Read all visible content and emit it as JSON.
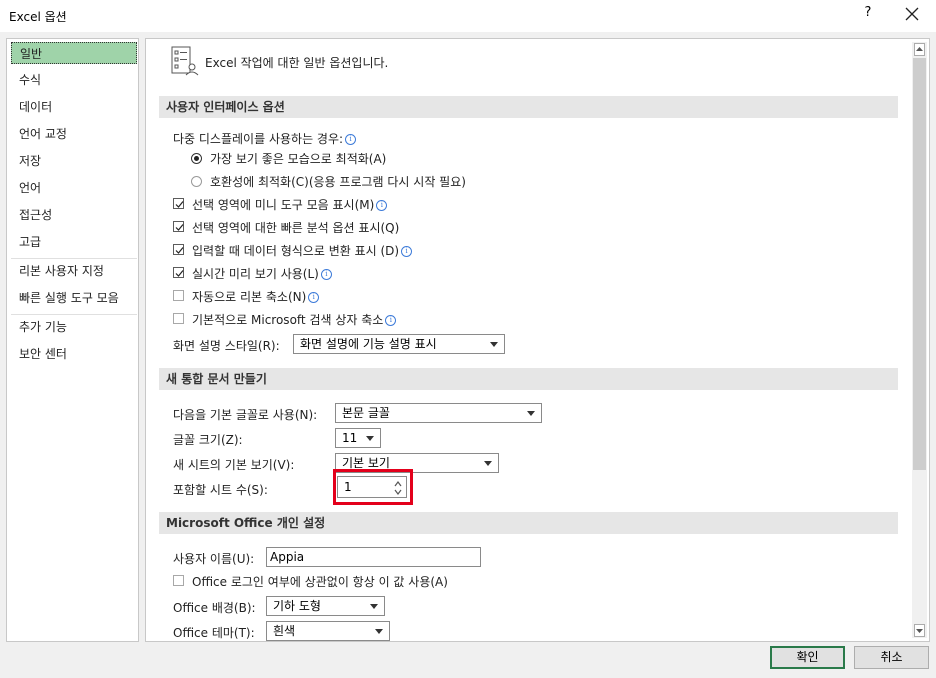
{
  "window": {
    "title": "Excel 옵션",
    "help": "?"
  },
  "sidebar": {
    "items": [
      {
        "label": "일반"
      },
      {
        "label": "수식"
      },
      {
        "label": "데이터"
      },
      {
        "label": "언어 교정"
      },
      {
        "label": "저장"
      },
      {
        "label": "언어"
      },
      {
        "label": "접근성"
      },
      {
        "label": "고급"
      },
      {
        "label": "리본 사용자 지정"
      },
      {
        "label": "빠른 실행 도구 모음"
      },
      {
        "label": "추가 기능"
      },
      {
        "label": "보안 센터"
      }
    ]
  },
  "header": {
    "text": "Excel 작업에 대한 일반 옵션입니다."
  },
  "ui_options": {
    "heading": "사용자 인터페이스 옵션",
    "multi_display_label": "다중 디스플레이를 사용하는 경우:",
    "radio_best": "가장 보기 좋은 모습으로 최적화(A)",
    "radio_compat": "호환성에 최적화(C)(응용 프로그램 다시 시작 필요)",
    "cb_mini_toolbar": "선택 영역에 미니 도구 모음 표시(M)",
    "cb_quick_analysis": "선택 영역에 대한 빠른 분석 옵션 표시(Q)",
    "cb_convert": "입력할 때 데이터 형식으로 변환 표시 (D)",
    "cb_live_preview": "실시간 미리 보기 사용(L)",
    "cb_collapse_ribbon": "자동으로 리본 축소(N)",
    "cb_collapse_search": "기본적으로 Microsoft 검색 상자 축소",
    "screentip_label": "화면 설명 스타일(R):",
    "screentip_value": "화면 설명에 기능 설명 표시"
  },
  "new_workbook": {
    "heading": "새 통합 문서 만들기",
    "font_label": "다음을 기본 글꼴로 사용(N):",
    "font_value": "본문 글꼴",
    "size_label": "글꼴 크기(Z):",
    "size_value": "11",
    "view_label": "새 시트의 기본 보기(V):",
    "view_value": "기본 보기",
    "sheets_label": "포함할 시트 수(S):",
    "sheets_value": "1"
  },
  "personalize": {
    "heading": "Microsoft Office 개인 설정",
    "username_label": "사용자 이름(U):",
    "username_value": "Appia",
    "always_use_label": "Office 로그인 여부에 상관없이 항상 이 값 사용(A)",
    "background_label": "Office 배경(B):",
    "background_value": "기하 도형",
    "theme_label": "Office 테마(T):",
    "theme_value": "흰색"
  },
  "footer": {
    "ok": "확인",
    "cancel": "취소"
  },
  "colors": {
    "selected_nav": "#9fd3a9",
    "highlight": "#e3001b",
    "info": "#3d7bd9"
  }
}
